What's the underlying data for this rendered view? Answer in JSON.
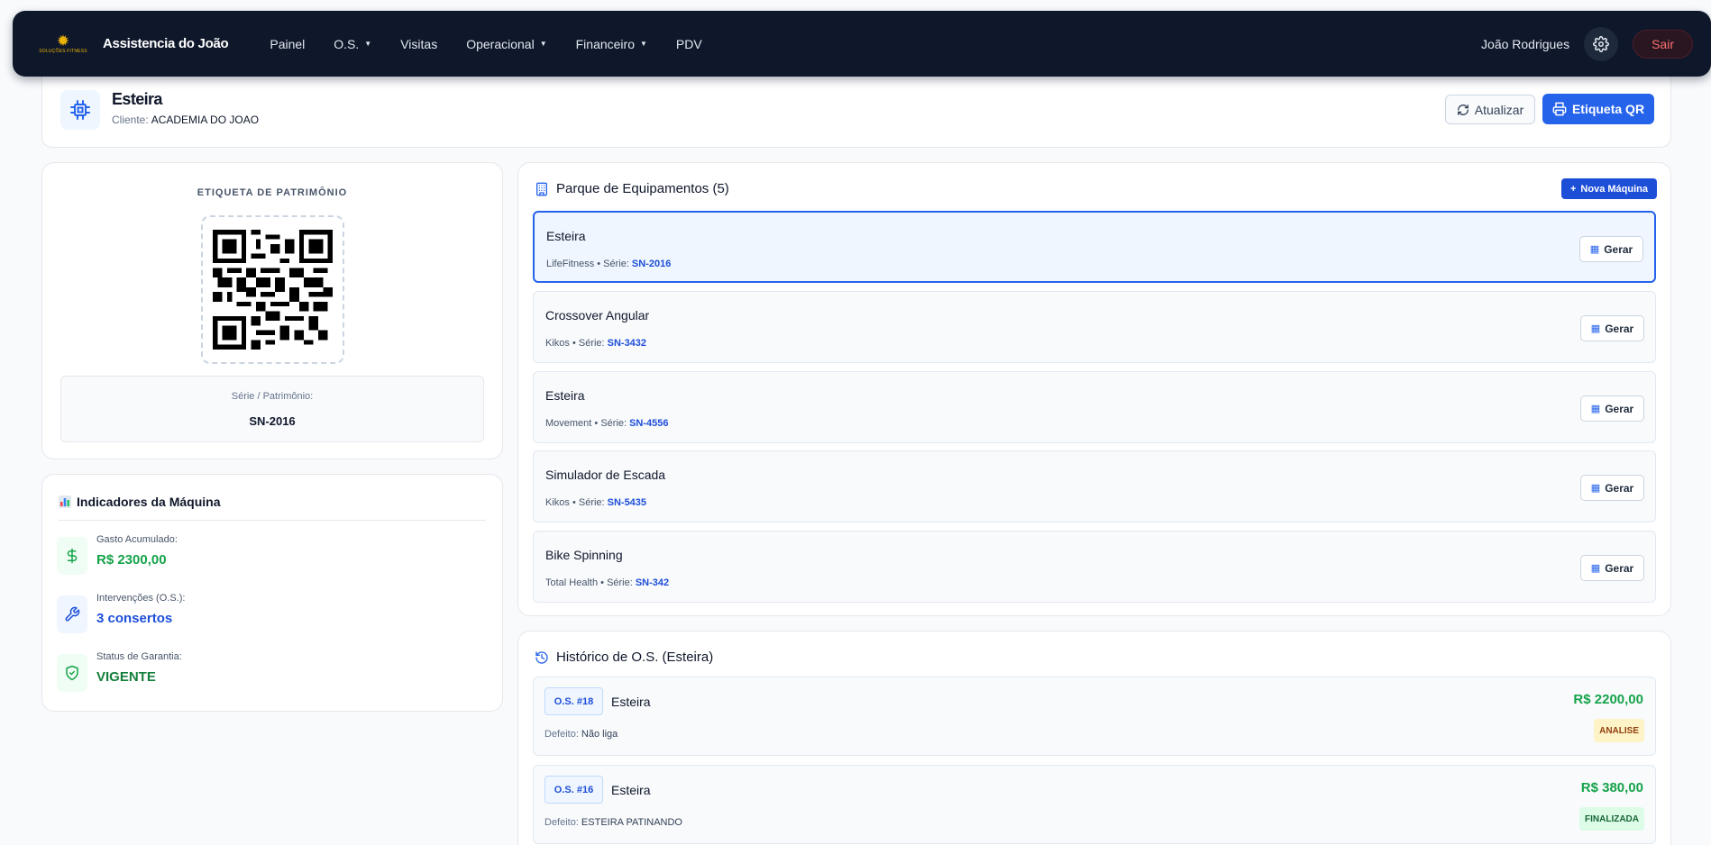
{
  "navbar": {
    "logo_text": "SOLUÇÕES FITNESS",
    "brand": "Assistencia do João",
    "links": [
      {
        "label": "Painel",
        "dropdown": false
      },
      {
        "label": "O.S.",
        "dropdown": true
      },
      {
        "label": "Visitas",
        "dropdown": false
      },
      {
        "label": "Operacional",
        "dropdown": true
      },
      {
        "label": "Financeiro",
        "dropdown": true
      },
      {
        "label": "PDV",
        "dropdown": false
      }
    ],
    "user": "João Rodrigues",
    "settings_icon": "gear-icon",
    "logout": "Sair"
  },
  "header": {
    "icon": "cpu-icon",
    "title": "Esteira",
    "client_label": "Cliente:",
    "client": "ACADEMIA DO JOAO",
    "refresh_label": "Atualizar",
    "qr_label": "Etiqueta QR"
  },
  "asset_tag": {
    "title": "ETIQUETA DE PATRIMÔNIO",
    "serial_label": "Série / Patrimônio:",
    "serial": "SN-2016"
  },
  "indicators": {
    "title": "Indicadores da Máquina",
    "metrics": [
      {
        "label": "Gasto Acumulado:",
        "value": "R$ 2300,00",
        "icon": "dollar-icon",
        "color": "#16a34a"
      },
      {
        "label": "Intervenções (O.S.):",
        "value": "3 consertos",
        "icon": "wrench-icon",
        "color": "#1d4ed8"
      },
      {
        "label": "Status de Garantia:",
        "value": "VIGENTE",
        "icon": "shield-check-icon",
        "color": "#15803d"
      }
    ]
  },
  "equipment": {
    "title": "Parque de Equipamentos (5)",
    "new_label": "Nova Máquina",
    "series_label": "Série:",
    "generate_label": "Gerar",
    "items": [
      {
        "name": "Esteira",
        "brand": "LifeFitness",
        "serial": "SN-2016",
        "selected": true
      },
      {
        "name": "Crossover Angular",
        "brand": "Kikos",
        "serial": "SN-3432",
        "selected": false
      },
      {
        "name": "Esteira",
        "brand": "Movement",
        "serial": "SN-4556",
        "selected": false
      },
      {
        "name": "Simulador de Escada",
        "brand": "Kikos",
        "serial": "SN-5435",
        "selected": false
      },
      {
        "name": "Bike Spinning",
        "brand": "Total Health",
        "serial": "SN-342",
        "selected": false
      }
    ]
  },
  "history": {
    "title": "Histórico de O.S. (Esteira)",
    "defect_label": "Defeito:",
    "items": [
      {
        "badge": "O.S. #18",
        "name": "Esteira",
        "defect": "Não liga",
        "price": "R$ 2200,00",
        "status": "ANALISE",
        "status_bg": "#fef3c7",
        "status_color": "#92400e"
      },
      {
        "badge": "O.S. #16",
        "name": "Esteira",
        "defect": "ESTEIRA PATINANDO",
        "price": "R$ 380,00",
        "status": "FINALIZADA",
        "status_bg": "#dcfce7",
        "status_color": "#166534"
      }
    ]
  }
}
